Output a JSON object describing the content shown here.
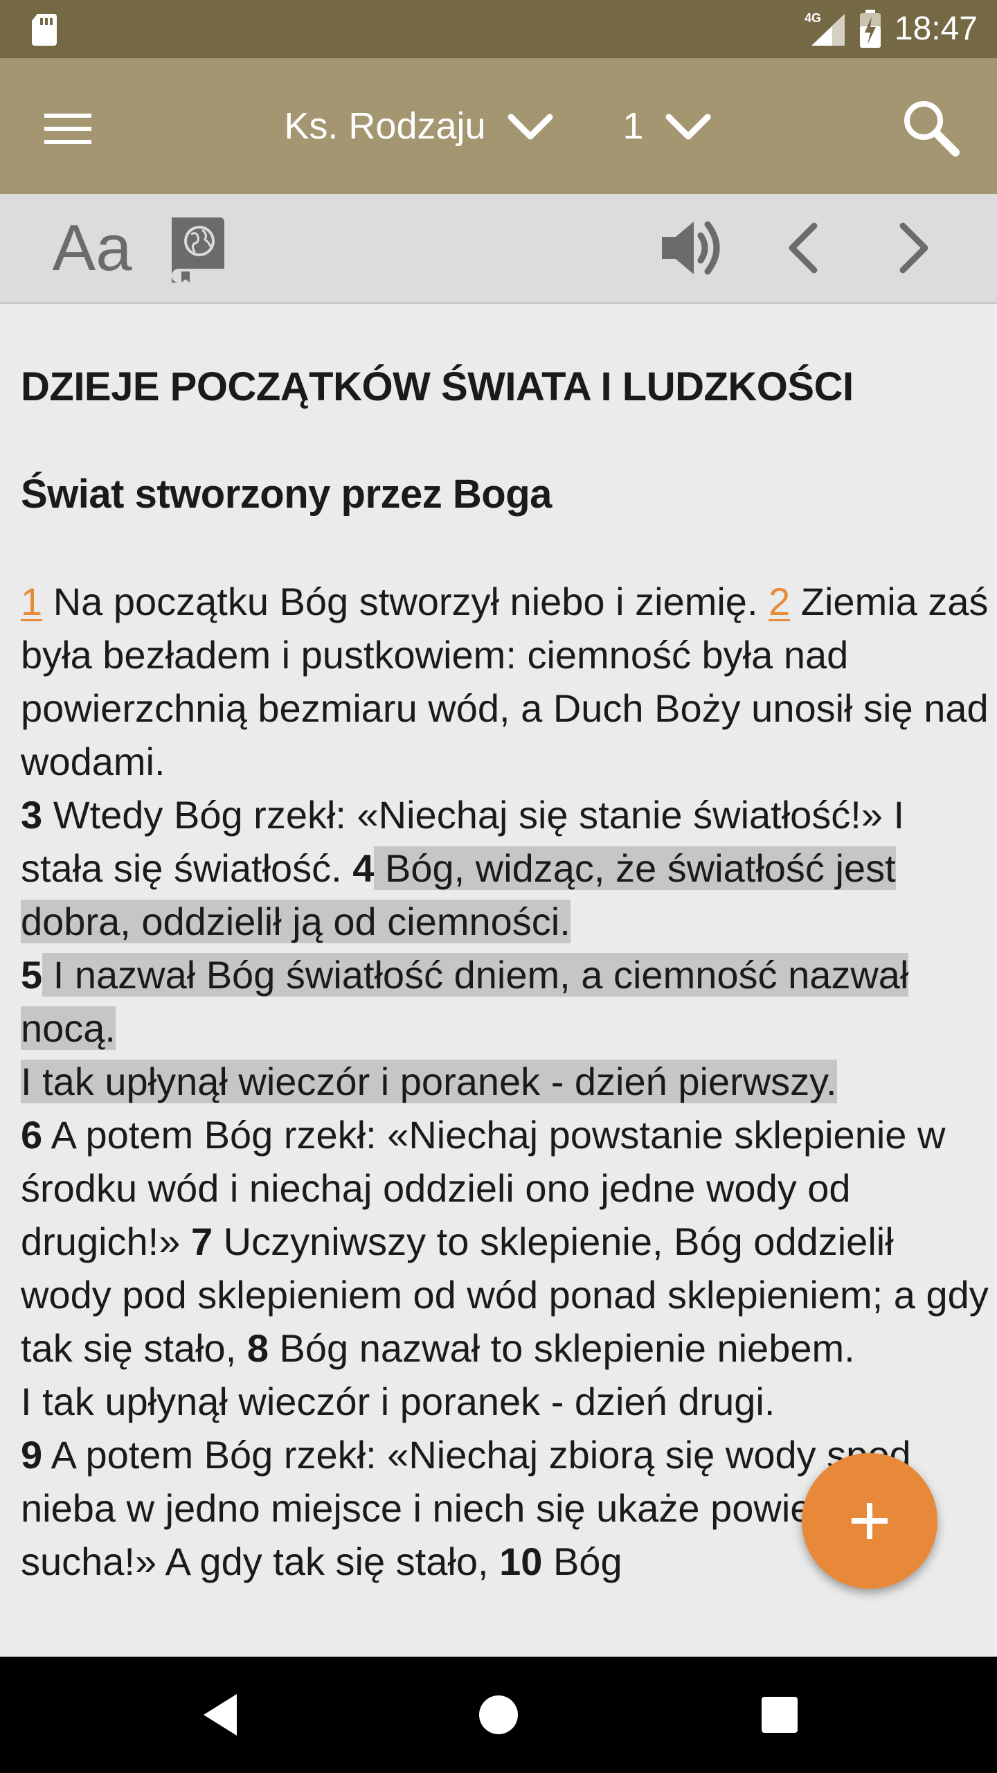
{
  "status_bar": {
    "time": "18:47",
    "network": "4G",
    "icons": [
      "sd-card-icon",
      "signal-icon",
      "battery-icon"
    ]
  },
  "app_bar": {
    "book": "Ks. Rodzaju",
    "chapter": "1",
    "icons": [
      "menu-icon",
      "chevron-down-icon",
      "search-icon"
    ]
  },
  "toolbar": {
    "font_label": "Aa",
    "icons": [
      "bible-globe-icon",
      "speaker-icon",
      "chevron-left-icon",
      "chevron-right-icon"
    ]
  },
  "content": {
    "heading1": "DZIEJE POCZĄTKÓW ŚWIATA I LUDZKOŚCI",
    "heading2": "Świat stworzony przez Boga",
    "verses": {
      "v1_num": "1",
      "v1_text": " Na początku Bóg stworzył niebo i ziemię. ",
      "v2_num": "2",
      "v2_text": " Ziemia zaś była bezładem i pustkowiem: ciemność była nad powierzchnią bezmiaru wód, a Duch Boży unosił się nad wodami.",
      "v3_num": "3",
      "v3_text": " Wtedy Bóg rzekł: «Niechaj się stanie światłość!» I stała się światłość. ",
      "v4_num": "4",
      "v4_text": " Bóg, widząc, że światłość jest dobra, oddzielił ją od ciemności.",
      "v5_num": "5",
      "v5_text": " I nazwał Bóg światłość dniem, a ciemność nazwał nocą.",
      "day1": "I tak upłynął wieczór i poranek - dzień pierwszy.",
      "v6_num": "6",
      "v6_text": " A potem Bóg rzekł: «Niechaj powstanie sklepienie w środku wód i niechaj oddzieli ono jedne wody od drugich!» ",
      "v7_num": "7",
      "v7_text": " Uczyniwszy to sklepienie, Bóg oddzielił wody pod sklepieniem od wód ponad sklepieniem; a gdy tak się stało, ",
      "v8_num": "8",
      "v8_text": " Bóg nazwał to sklepienie niebem.",
      "day2": "I tak upłynął wieczór i poranek - dzień drugi.",
      "v9_num": "9",
      "v9_text": " A potem Bóg rzekł: «Niechaj zbiorą się wody spod nieba w jedno miejsce i niech się ukaże powierzchnia sucha!» A gdy tak się stało, ",
      "v10_num": "10",
      "v10_text": " Bóg"
    },
    "highlight_color": "#c6c6c6",
    "link_color": "#e58b3a"
  },
  "fab": {
    "icon": "plus-icon",
    "color": "#e8893a"
  },
  "nav_bar": {
    "icons": [
      "back-icon",
      "home-icon",
      "recents-icon"
    ]
  },
  "colors": {
    "status_bar": "#746845",
    "app_bar": "#a39671",
    "toolbar": "#dcdcdc",
    "background": "#ebebeb"
  }
}
